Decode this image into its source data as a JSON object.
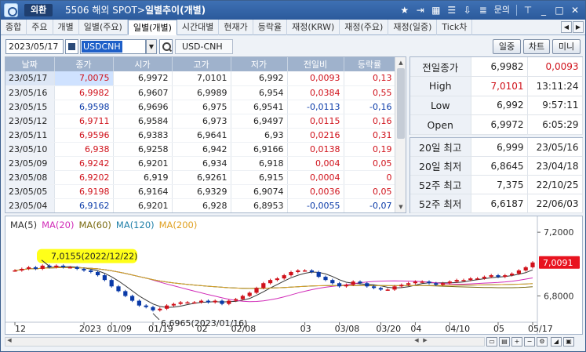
{
  "titlebar": {
    "category": "외환",
    "screen": "5506 해외 SPOT>",
    "screen_bold": "일별추이(개별)",
    "icons": [
      "star-icon",
      "export-icon",
      "grid-icon",
      "menu-icon",
      "download-icon",
      "list-icon"
    ],
    "help": "문의",
    "window_icons": [
      "pin-icon",
      "minimize-icon",
      "maximize-icon",
      "close-icon"
    ]
  },
  "tabs": [
    "종합",
    "주요",
    "개별",
    "일별(주요)",
    "일별(개별)",
    "시간대별",
    "현재가",
    "등락율",
    "재정(KRW)",
    "재정(주요)",
    "재정(일중)",
    "Tick차"
  ],
  "active_tab": 4,
  "toolbar": {
    "date": "2023/05/17",
    "symbol": "USDCNH",
    "symbol_name": "USD-CNH",
    "btn_intraday": "일중",
    "btn_chart": "차트",
    "btn_mini": "미니"
  },
  "grid": {
    "headers": [
      "날짜",
      "종가",
      "시가",
      "고가",
      "저가",
      "전일비",
      "등락률"
    ],
    "rows": [
      {
        "date": "23/05/17",
        "close": "7,0075",
        "open": "6,9972",
        "high": "7,0101",
        "low": "6,992",
        "chg": "0,0093",
        "pct": "0,13",
        "dir": "up"
      },
      {
        "date": "23/05/16",
        "close": "6,9982",
        "open": "6,9607",
        "high": "6,9989",
        "low": "6,954",
        "chg": "0,0384",
        "pct": "0,55",
        "dir": "up"
      },
      {
        "date": "23/05/15",
        "close": "6,9598",
        "open": "6,9696",
        "high": "6,975",
        "low": "6,9541",
        "chg": "-0,0113",
        "pct": "-0,16",
        "dir": "dn"
      },
      {
        "date": "23/05/12",
        "close": "6,9711",
        "open": "6,9584",
        "high": "6,973",
        "low": "6,9497",
        "chg": "0,0115",
        "pct": "0,16",
        "dir": "up"
      },
      {
        "date": "23/05/11",
        "close": "6,9596",
        "open": "6,9383",
        "high": "6,9641",
        "low": "6,93",
        "chg": "0,0216",
        "pct": "0,31",
        "dir": "up"
      },
      {
        "date": "23/05/10",
        "close": "6,938",
        "open": "6,9258",
        "high": "6,942",
        "low": "6,9166",
        "chg": "0,0138",
        "pct": "0,19",
        "dir": "up"
      },
      {
        "date": "23/05/09",
        "close": "6,9242",
        "open": "6,9201",
        "high": "6,934",
        "low": "6,918",
        "chg": "0,004",
        "pct": "0,05",
        "dir": "up"
      },
      {
        "date": "23/05/08",
        "close": "6,9202",
        "open": "6,919",
        "high": "6,9261",
        "low": "6,915",
        "chg": "0,0004",
        "pct": "0",
        "dir": "up"
      },
      {
        "date": "23/05/05",
        "close": "6,9198",
        "open": "6,9164",
        "high": "6,9329",
        "low": "6,9074",
        "chg": "0,0036",
        "pct": "0,05",
        "dir": "up"
      },
      {
        "date": "23/05/04",
        "close": "6,9162",
        "open": "6,9201",
        "high": "6,928",
        "low": "6,8953",
        "chg": "-0,0055",
        "pct": "-0,07",
        "dir": "dn"
      }
    ]
  },
  "info": {
    "rows": [
      {
        "k": "전일종가",
        "v1": "6,9982",
        "v2": "0,0093",
        "v2color": "up"
      },
      {
        "k": "High",
        "v1": "7,0101",
        "v1color": "up",
        "v2": "13:11:24"
      },
      {
        "k": "Low",
        "v1": "6,992",
        "v2": "9:57:11"
      },
      {
        "k": "Open",
        "v1": "6,9972",
        "v2": "6:05:29"
      }
    ]
  },
  "info2": {
    "rows": [
      {
        "k": "20일 최고",
        "v1": "6,999",
        "v2": "23/05/16"
      },
      {
        "k": "20일 최저",
        "v1": "6,8645",
        "v2": "23/04/18"
      },
      {
        "k": "52주 최고",
        "v1": "7,375",
        "v2": "22/10/25"
      },
      {
        "k": "52주 최저",
        "v1": "6,6187",
        "v2": "22/06/03"
      }
    ]
  },
  "chart_data": {
    "type": "line",
    "legend": [
      {
        "name": "MA(5)",
        "color": "#333333"
      },
      {
        "name": "MA(20)",
        "color": "#d12bb8"
      },
      {
        "name": "MA(60)",
        "color": "#7a6a10"
      },
      {
        "name": "MA(120)",
        "color": "#1f7fa8"
      },
      {
        "name": "MA(200)",
        "color": "#e0a020"
      }
    ],
    "y_ticks": [
      "7,2000",
      "6,8000"
    ],
    "ylim": [
      6.65,
      7.25
    ],
    "current_label": "7,0091",
    "x_ticks": [
      "12",
      "2023",
      "01/09",
      "01/19",
      "02",
      "02/08",
      "03",
      "03/08",
      "03/20",
      "04",
      "04/10",
      "05",
      "05/17"
    ],
    "annotation_high": "7,0155(2022/12/22)",
    "annotation_low": "6,6965(2023/01/16)",
    "close": [
      6.96,
      6.97,
      6.98,
      6.97,
      6.99,
      6.98,
      6.99,
      6.98,
      6.98,
      6.97,
      6.96,
      6.95,
      6.93,
      6.9,
      6.86,
      6.83,
      6.8,
      6.77,
      6.74,
      6.73,
      6.71,
      6.72,
      6.74,
      6.75,
      6.76,
      6.76,
      6.76,
      6.77,
      6.76,
      6.77,
      6.75,
      6.77,
      6.78,
      6.8,
      6.82,
      6.85,
      6.88,
      6.9,
      6.91,
      6.93,
      6.95,
      6.96,
      6.96,
      6.95,
      6.92,
      6.9,
      6.88,
      6.86,
      6.87,
      6.89,
      6.88,
      6.86,
      6.85,
      6.84,
      6.84,
      6.86,
      6.87,
      6.88,
      6.89,
      6.89,
      6.88,
      6.87,
      6.88,
      6.89,
      6.9,
      6.9,
      6.91,
      6.91,
      6.92,
      6.93,
      6.92,
      6.93,
      6.94,
      6.96,
      6.98,
      7.01
    ]
  },
  "scroll_icons": [
    "layout-1-icon",
    "layout-2-icon",
    "zoom-in-icon",
    "zoom-out-icon",
    "settings-icon"
  ]
}
